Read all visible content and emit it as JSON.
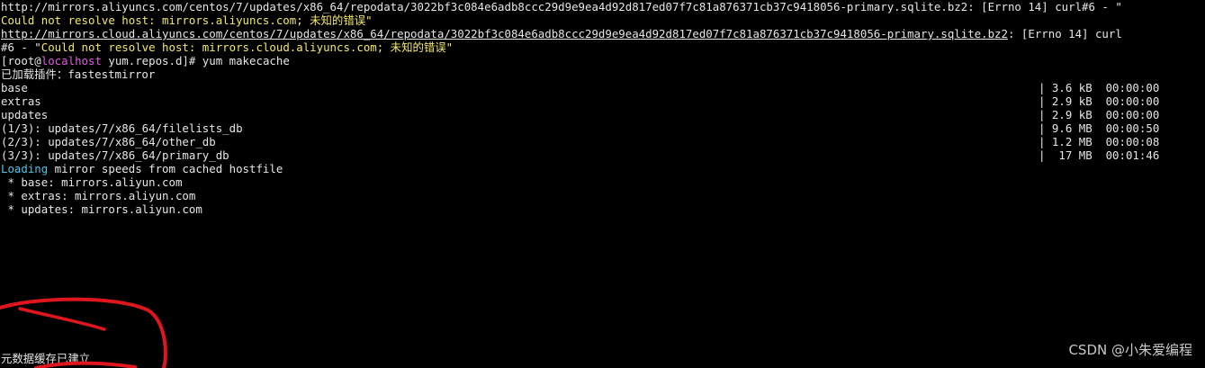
{
  "terminal": {
    "lines": {
      "l1": "http://mirrors.aliyuncs.com/centos/7/updates/x86_64/repodata/3022bf3c084e6adb8ccc29d9e9ea4d92d817ed07f7c81a876371cb37c9418056-primary.sqlite.bz2: [Errno 14] curl#6 - \"",
      "l2": "Could not resolve host: mirrors.aliyuncs.com; 未知的错误\"",
      "l3_url": "http://mirrors.cloud.aliyuncs.com/centos/7/updates/x86_64/repodata/3022bf3c084e6adb8ccc29d9e9ea4d92d817ed07f7c81a876371cb37c9418056-primary.sqlite.bz2",
      "l3_rest": ": [Errno 14] curl",
      "l4_pre": "#6 - \"",
      "l4_msg": "Could not resolve host: mirrors.cloud.aliyuncs.com; 未知的错误\"",
      "prompt_open": "[root@",
      "prompt_host": "localhost",
      "prompt_rest": " yum.repos.d]# yum makecache",
      "plugins": "已加载插件：fastestmirror",
      "loading_word": "Loading",
      "loading_rest": " mirror speeds from cached hostfile",
      "mirror_base": " * base: mirrors.aliyun.com",
      "mirror_extras": " * extras: mirrors.aliyun.com",
      "mirror_updates": " * updates: mirrors.aliyun.com",
      "final": "元数据缓存已建立"
    },
    "repos": [
      {
        "name": "base",
        "size": "| 3.6 kB  00:00:00"
      },
      {
        "name": "extras",
        "size": "| 2.9 kB  00:00:00"
      },
      {
        "name": "updates",
        "size": "| 2.9 kB  00:00:00"
      },
      {
        "name": "(1/3): updates/7/x86_64/filelists_db",
        "size": "| 9.6 MB  00:00:50"
      },
      {
        "name": "(2/3): updates/7/x86_64/other_db",
        "size": "| 1.2 MB  00:00:08"
      },
      {
        "name": "(3/3): updates/7/x86_64/primary_db",
        "size": "|  17 MB  00:01:46"
      }
    ]
  },
  "watermark": "CSDN @小朱爱编程",
  "colors": {
    "background": "#000000",
    "text": "#e6e6e6",
    "error_yellow": "#f2e86a",
    "host_magenta": "#e05be0",
    "loading_cyan": "#4ec6e6",
    "annotation_red": "#e0161e"
  }
}
